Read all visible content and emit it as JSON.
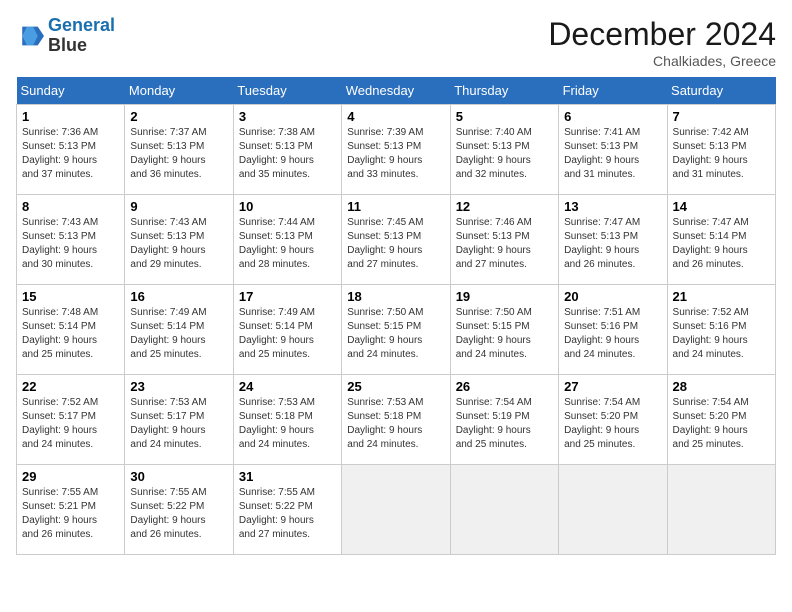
{
  "logo": {
    "line1": "General",
    "line2": "Blue"
  },
  "title": "December 2024",
  "subtitle": "Chalkiades, Greece",
  "days_of_week": [
    "Sunday",
    "Monday",
    "Tuesday",
    "Wednesday",
    "Thursday",
    "Friday",
    "Saturday"
  ],
  "weeks": [
    [
      {
        "day": "1",
        "info": "Sunrise: 7:36 AM\nSunset: 5:13 PM\nDaylight: 9 hours\nand 37 minutes."
      },
      {
        "day": "2",
        "info": "Sunrise: 7:37 AM\nSunset: 5:13 PM\nDaylight: 9 hours\nand 36 minutes."
      },
      {
        "day": "3",
        "info": "Sunrise: 7:38 AM\nSunset: 5:13 PM\nDaylight: 9 hours\nand 35 minutes."
      },
      {
        "day": "4",
        "info": "Sunrise: 7:39 AM\nSunset: 5:13 PM\nDaylight: 9 hours\nand 33 minutes."
      },
      {
        "day": "5",
        "info": "Sunrise: 7:40 AM\nSunset: 5:13 PM\nDaylight: 9 hours\nand 32 minutes."
      },
      {
        "day": "6",
        "info": "Sunrise: 7:41 AM\nSunset: 5:13 PM\nDaylight: 9 hours\nand 31 minutes."
      },
      {
        "day": "7",
        "info": "Sunrise: 7:42 AM\nSunset: 5:13 PM\nDaylight: 9 hours\nand 31 minutes."
      }
    ],
    [
      {
        "day": "8",
        "info": "Sunrise: 7:43 AM\nSunset: 5:13 PM\nDaylight: 9 hours\nand 30 minutes."
      },
      {
        "day": "9",
        "info": "Sunrise: 7:43 AM\nSunset: 5:13 PM\nDaylight: 9 hours\nand 29 minutes."
      },
      {
        "day": "10",
        "info": "Sunrise: 7:44 AM\nSunset: 5:13 PM\nDaylight: 9 hours\nand 28 minutes."
      },
      {
        "day": "11",
        "info": "Sunrise: 7:45 AM\nSunset: 5:13 PM\nDaylight: 9 hours\nand 27 minutes."
      },
      {
        "day": "12",
        "info": "Sunrise: 7:46 AM\nSunset: 5:13 PM\nDaylight: 9 hours\nand 27 minutes."
      },
      {
        "day": "13",
        "info": "Sunrise: 7:47 AM\nSunset: 5:13 PM\nDaylight: 9 hours\nand 26 minutes."
      },
      {
        "day": "14",
        "info": "Sunrise: 7:47 AM\nSunset: 5:14 PM\nDaylight: 9 hours\nand 26 minutes."
      }
    ],
    [
      {
        "day": "15",
        "info": "Sunrise: 7:48 AM\nSunset: 5:14 PM\nDaylight: 9 hours\nand 25 minutes."
      },
      {
        "day": "16",
        "info": "Sunrise: 7:49 AM\nSunset: 5:14 PM\nDaylight: 9 hours\nand 25 minutes."
      },
      {
        "day": "17",
        "info": "Sunrise: 7:49 AM\nSunset: 5:14 PM\nDaylight: 9 hours\nand 25 minutes."
      },
      {
        "day": "18",
        "info": "Sunrise: 7:50 AM\nSunset: 5:15 PM\nDaylight: 9 hours\nand 24 minutes."
      },
      {
        "day": "19",
        "info": "Sunrise: 7:50 AM\nSunset: 5:15 PM\nDaylight: 9 hours\nand 24 minutes."
      },
      {
        "day": "20",
        "info": "Sunrise: 7:51 AM\nSunset: 5:16 PM\nDaylight: 9 hours\nand 24 minutes."
      },
      {
        "day": "21",
        "info": "Sunrise: 7:52 AM\nSunset: 5:16 PM\nDaylight: 9 hours\nand 24 minutes."
      }
    ],
    [
      {
        "day": "22",
        "info": "Sunrise: 7:52 AM\nSunset: 5:17 PM\nDaylight: 9 hours\nand 24 minutes."
      },
      {
        "day": "23",
        "info": "Sunrise: 7:53 AM\nSunset: 5:17 PM\nDaylight: 9 hours\nand 24 minutes."
      },
      {
        "day": "24",
        "info": "Sunrise: 7:53 AM\nSunset: 5:18 PM\nDaylight: 9 hours\nand 24 minutes."
      },
      {
        "day": "25",
        "info": "Sunrise: 7:53 AM\nSunset: 5:18 PM\nDaylight: 9 hours\nand 24 minutes."
      },
      {
        "day": "26",
        "info": "Sunrise: 7:54 AM\nSunset: 5:19 PM\nDaylight: 9 hours\nand 25 minutes."
      },
      {
        "day": "27",
        "info": "Sunrise: 7:54 AM\nSunset: 5:20 PM\nDaylight: 9 hours\nand 25 minutes."
      },
      {
        "day": "28",
        "info": "Sunrise: 7:54 AM\nSunset: 5:20 PM\nDaylight: 9 hours\nand 25 minutes."
      }
    ],
    [
      {
        "day": "29",
        "info": "Sunrise: 7:55 AM\nSunset: 5:21 PM\nDaylight: 9 hours\nand 26 minutes."
      },
      {
        "day": "30",
        "info": "Sunrise: 7:55 AM\nSunset: 5:22 PM\nDaylight: 9 hours\nand 26 minutes."
      },
      {
        "day": "31",
        "info": "Sunrise: 7:55 AM\nSunset: 5:22 PM\nDaylight: 9 hours\nand 27 minutes."
      },
      {
        "day": "",
        "info": ""
      },
      {
        "day": "",
        "info": ""
      },
      {
        "day": "",
        "info": ""
      },
      {
        "day": "",
        "info": ""
      }
    ]
  ]
}
